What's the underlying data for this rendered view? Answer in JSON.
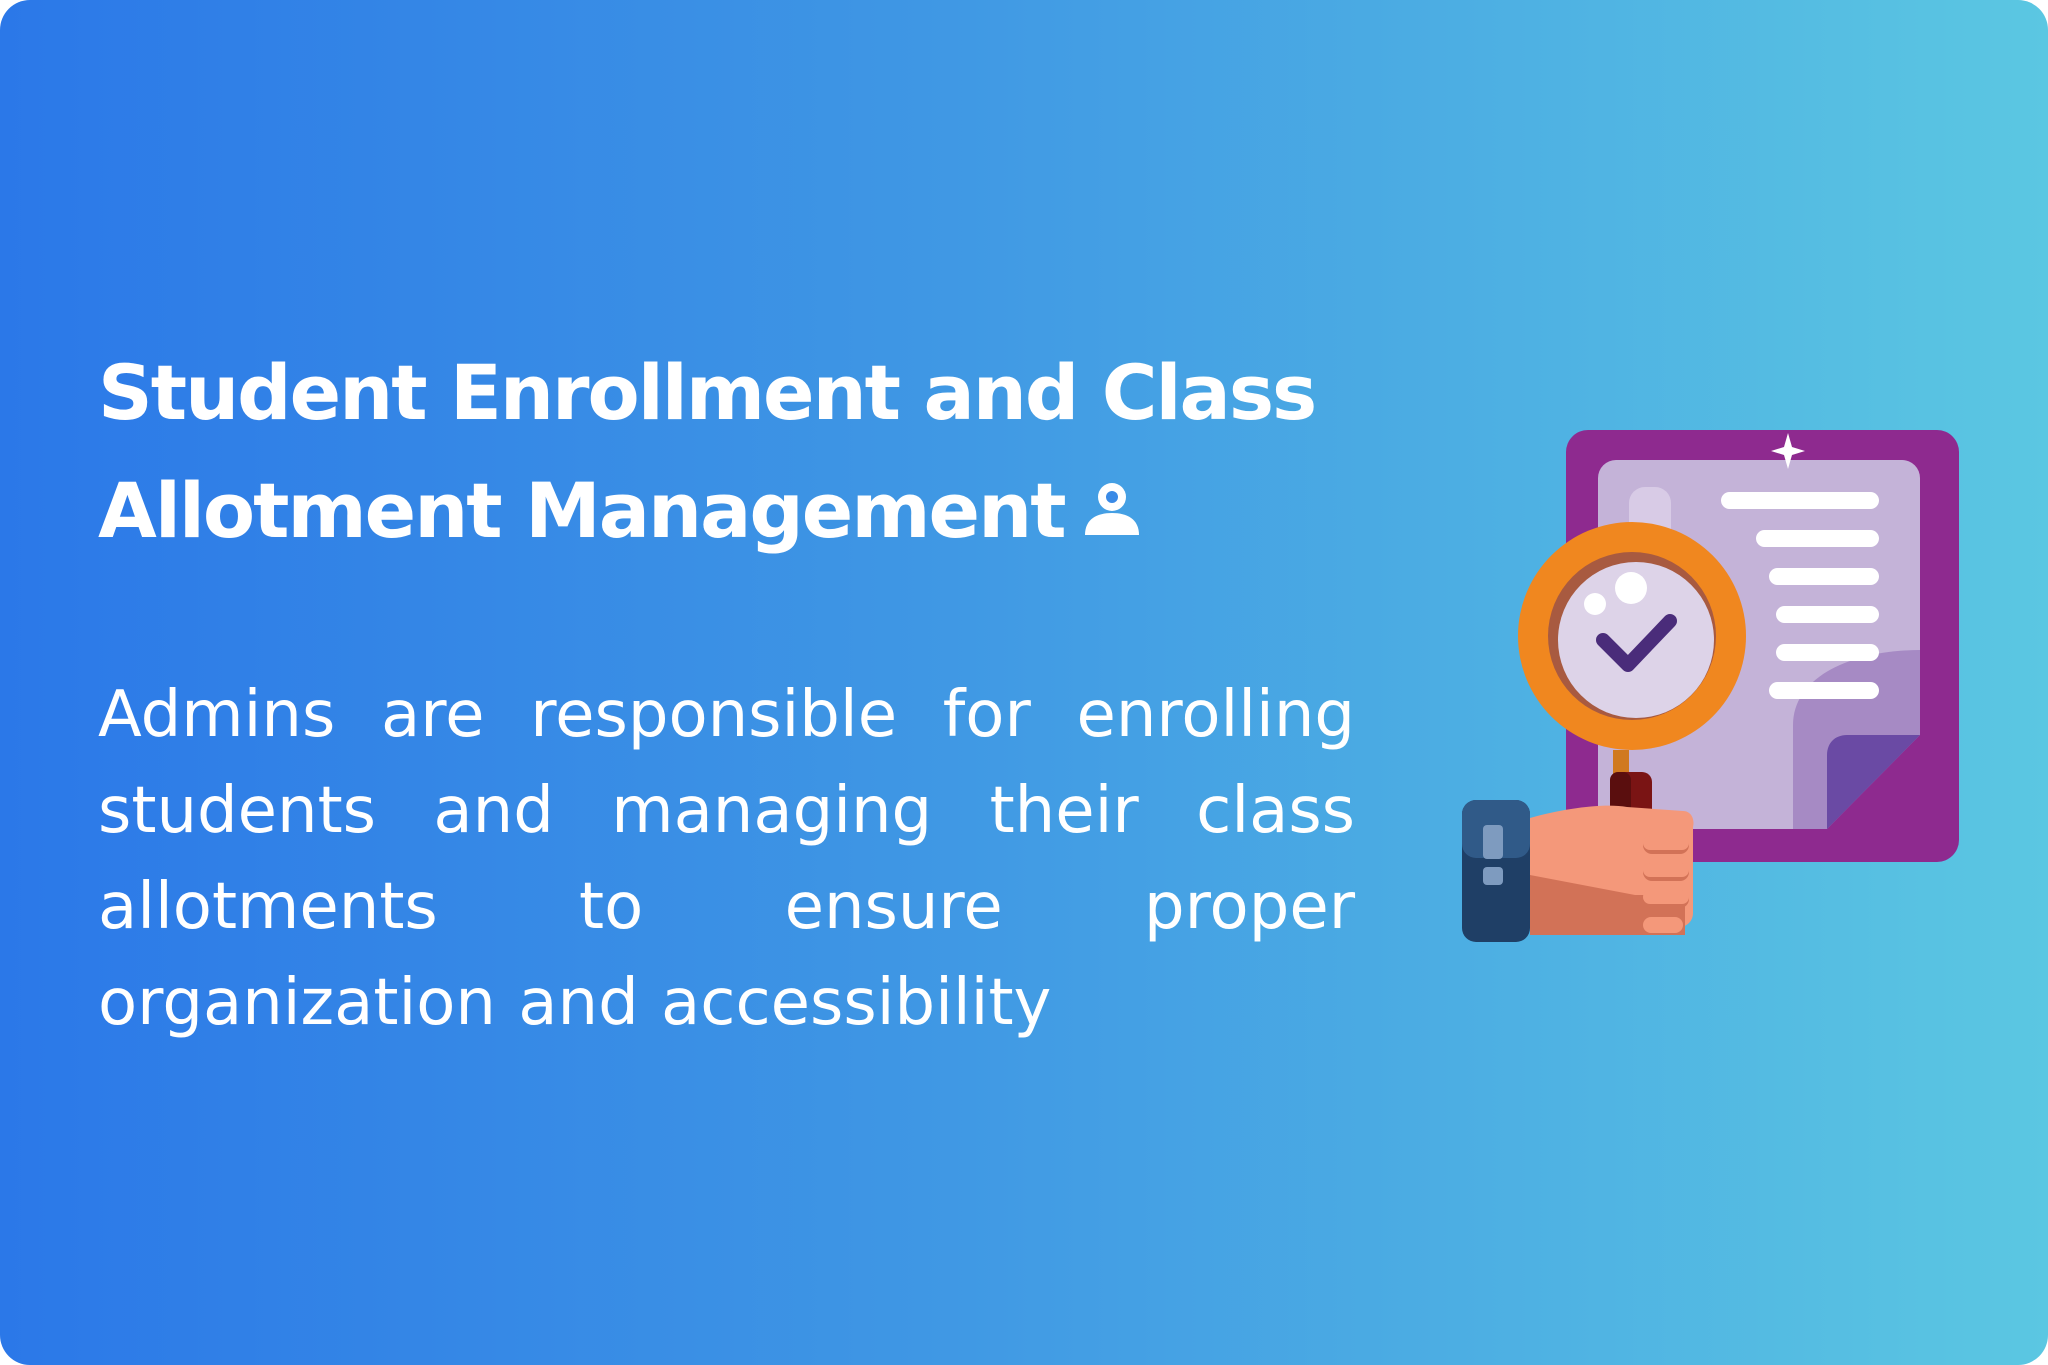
{
  "slide": {
    "title_line1": "Student Enrollment and Class",
    "title_line2": "Allotment Management",
    "title_icon": "user-icon",
    "description": "Admins are responsible for enrolling students and managing their class allotments to ensure proper organization and accessibility"
  },
  "illustration": {
    "name": "magnifying-glass-document-check",
    "icons": [
      "document-icon",
      "magnifying-glass-icon",
      "checkmark-icon",
      "hand-icon",
      "sparkle-icon"
    ]
  },
  "colors": {
    "gradient_start": "#2b78e8",
    "gradient_end": "#5bc7e2",
    "text": "#ffffff",
    "document_frame": "#8e2a8f",
    "document_page": "#c4b3d8",
    "magnifier_ring": "#f0871f",
    "checkmark": "#4a2c7a",
    "hand_skin": "#f4987a",
    "sleeve": "#1f3f66"
  }
}
